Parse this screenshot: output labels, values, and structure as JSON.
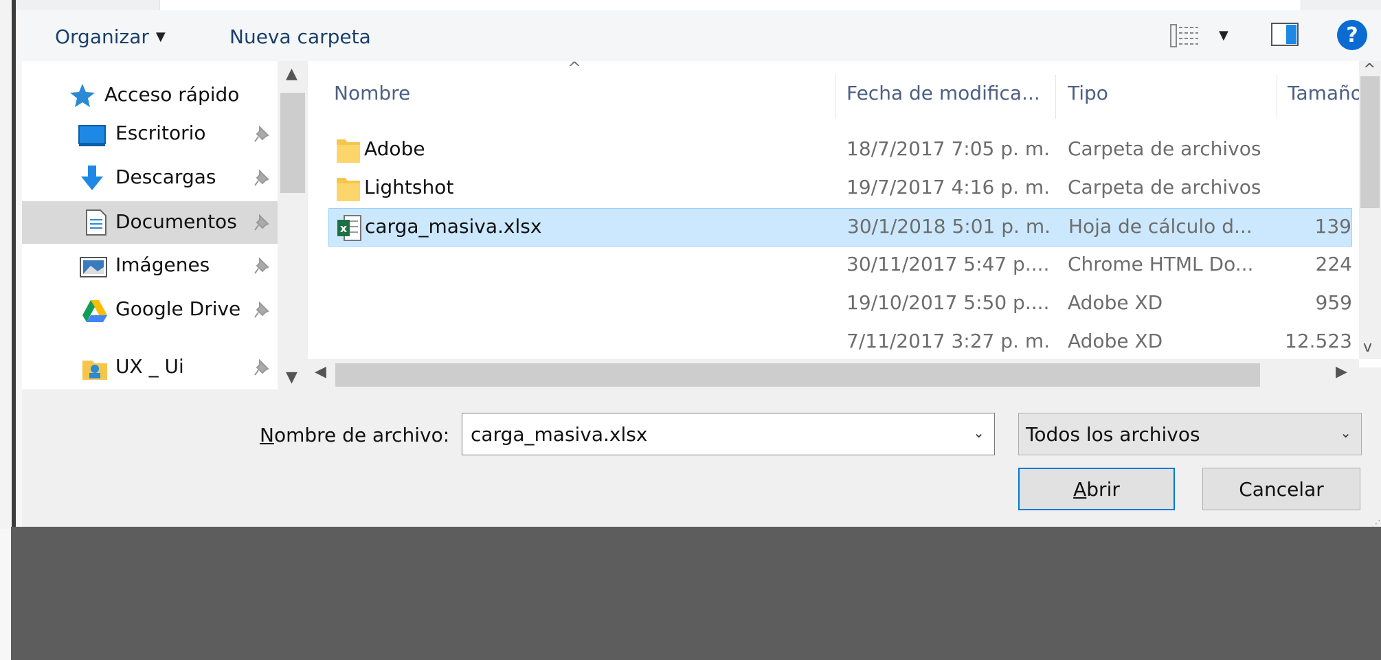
{
  "toolbar": {
    "organize_label": "Organizar",
    "new_folder_label": "Nueva carpeta",
    "help_label": "?",
    "icons": {
      "view": "view-list-icon",
      "preview": "preview-pane-icon",
      "help": "help-icon"
    }
  },
  "nav": {
    "items": [
      {
        "label": "Acceso rápido",
        "icon": "quick-access-star-icon"
      },
      {
        "label": "Escritorio",
        "icon": "desktop-icon",
        "pinned": true
      },
      {
        "label": "Descargas",
        "icon": "download-arrow-icon",
        "pinned": true
      },
      {
        "label": "Documentos",
        "icon": "documents-icon",
        "pinned": true,
        "selected": true
      },
      {
        "label": "Imágenes",
        "icon": "pictures-icon",
        "pinned": true
      },
      {
        "label": "Google Drive",
        "icon": "google-drive-icon",
        "pinned": true
      },
      {
        "label": "UX _ Ui",
        "icon": "folder-user-icon",
        "pinned": true
      }
    ]
  },
  "filelist": {
    "columns": {
      "name": "Nombre",
      "date": "Fecha de modifica...",
      "type": "Tipo",
      "size": "Tamaño"
    },
    "rows": [
      {
        "name": "Adobe",
        "date": "18/7/2017 7:05 p. m.",
        "type": "Carpeta de archivos",
        "size": "",
        "icon": "folder-icon"
      },
      {
        "name": "Lightshot",
        "date": "19/7/2017 4:16 p. m.",
        "type": "Carpeta de archivos",
        "size": "",
        "icon": "folder-icon"
      },
      {
        "name": "carga_masiva.xlsx",
        "date": "30/1/2018 5:01 p. m.",
        "type": "Hoja de cálculo d...",
        "size": "139",
        "icon": "excel-file-icon",
        "selected": true
      },
      {
        "name": "",
        "date": "30/11/2017 5:47 p....",
        "type": "Chrome HTML Do...",
        "size": "224",
        "icon": ""
      },
      {
        "name": "",
        "date": "19/10/2017 5:50 p....",
        "type": "Adobe XD",
        "size": "959",
        "icon": ""
      },
      {
        "name": "",
        "date": "7/11/2017 3:27 p. m.",
        "type": "Adobe XD",
        "size": "12.523",
        "icon": ""
      }
    ]
  },
  "footer": {
    "filename_label_mnemonic": "N",
    "filename_label_rest": "ombre de archivo:",
    "filename_value": "carga_masiva.xlsx",
    "filter_value": "Todos los archivos",
    "open_mnemonic": "A",
    "open_rest": "brir",
    "cancel_label": "Cancelar"
  },
  "colors": {
    "accent": "#0078d7",
    "selection": "#cce8ff",
    "selection_border": "#99d1ff",
    "desktop": "#5d5d5d",
    "help": "#0a6bd2"
  }
}
